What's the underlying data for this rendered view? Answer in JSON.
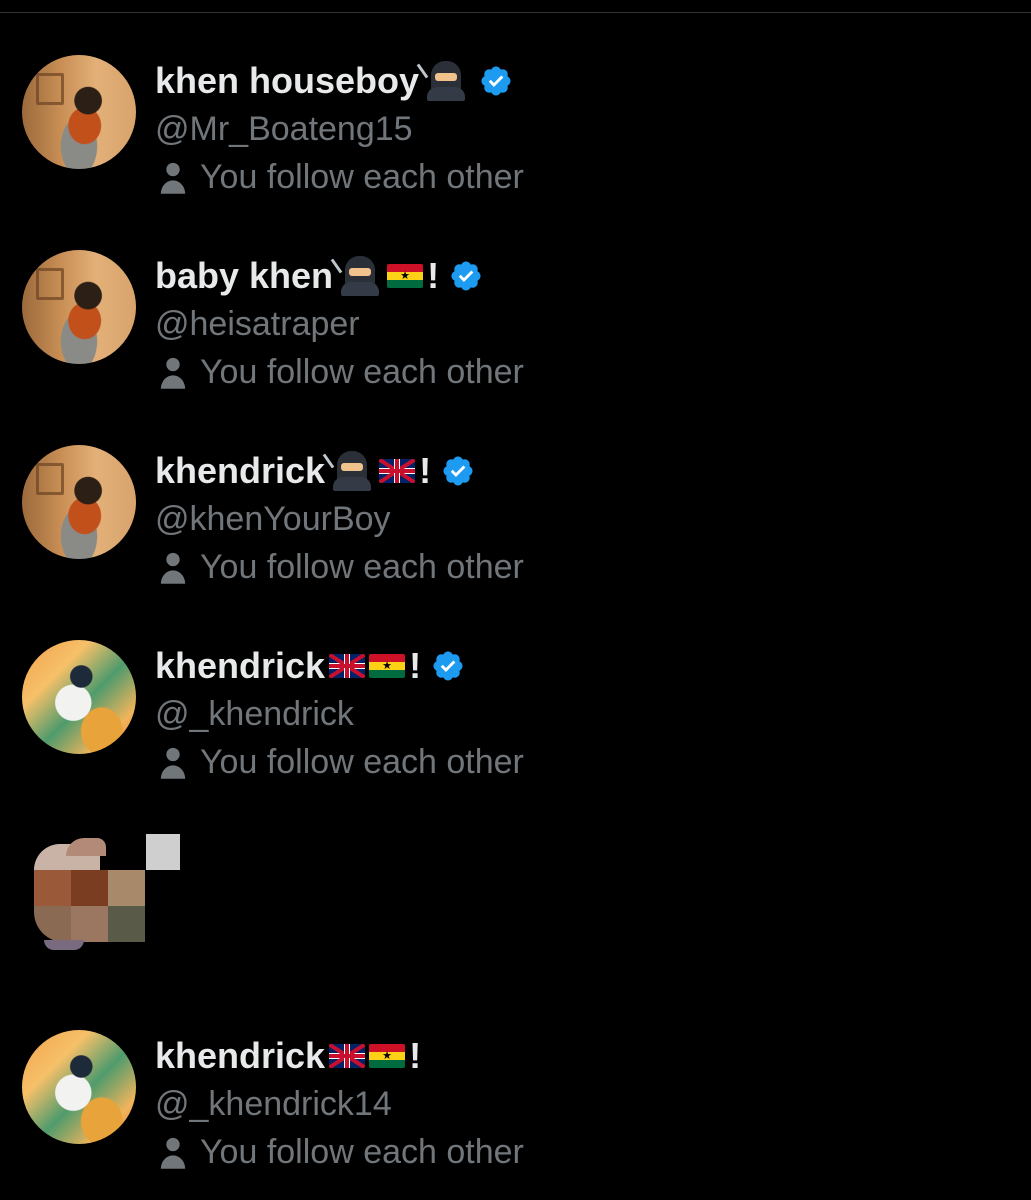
{
  "colors": {
    "background": "#000000",
    "name_text": "#e7e9ea",
    "secondary_text": "#71767b",
    "verified_badge": "#1d9bf0"
  },
  "users": [
    {
      "display_name": "khen houseboy",
      "emojis": [
        "ninja"
      ],
      "exclamation": "",
      "verified": true,
      "handle": "@Mr_Boateng15",
      "relationship": "You follow each other",
      "avatar": "ninja-photo"
    },
    {
      "display_name": "baby khen",
      "emojis": [
        "ninja",
        "flag-ghana"
      ],
      "exclamation": "!",
      "verified": true,
      "handle": "@heisatraper",
      "relationship": "You follow each other",
      "avatar": "ninja-photo"
    },
    {
      "display_name": "khendrick",
      "emojis": [
        "ninja",
        "flag-uk"
      ],
      "exclamation": "!",
      "verified": true,
      "handle": "@khenYourBoy",
      "relationship": "You follow each other",
      "avatar": "ninja-photo"
    },
    {
      "display_name": "khendrick",
      "emojis": [
        "flag-uk",
        "flag-ghana"
      ],
      "exclamation": "!",
      "verified": true,
      "handle": "@_khendrick",
      "relationship": "You follow each other",
      "avatar": "orange-photo"
    },
    {
      "display_name": "",
      "emojis": [],
      "exclamation": "",
      "verified": false,
      "handle": "",
      "relationship": "",
      "avatar": "pixelated-blurred",
      "redacted": true
    },
    {
      "display_name": "khendrick",
      "emojis": [
        "flag-uk",
        "flag-ghana"
      ],
      "exclamation": "!",
      "verified": false,
      "handle": "@_khendrick14",
      "relationship": "You follow each other",
      "avatar": "orange-photo"
    }
  ],
  "icons": {
    "person": "person-icon",
    "verified": "verified-badge-icon"
  }
}
